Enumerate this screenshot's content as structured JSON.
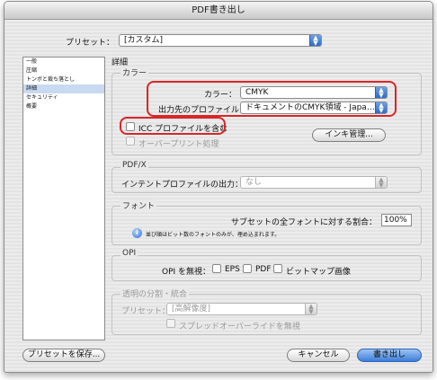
{
  "window": {
    "title": "PDF書き出し"
  },
  "preset": {
    "label": "プリセット：",
    "value": "[カスタム]"
  },
  "sidebar": {
    "items": [
      {
        "label": "一般"
      },
      {
        "label": "圧縮"
      },
      {
        "label": "トンボと裁ち落とし"
      },
      {
        "label": "詳細"
      },
      {
        "label": "セキュリティ"
      },
      {
        "label": "概要"
      }
    ]
  },
  "section_title": "詳細",
  "color": {
    "title": "カラー",
    "color_label": "カラー：",
    "color_value": "CMYK",
    "profile_label": "出力先のプロファイル：",
    "profile_value": "ドキュメントのCMYK領域 - Japa…",
    "icc_label": "ICC プロファイルを含む",
    "overprint_label": "オーバープリント処理",
    "ink_button": "インキ管理..."
  },
  "pdfx": {
    "title": "PDF/X",
    "intent_label": "インテントプロファイルの出力：",
    "intent_value": "なし"
  },
  "fonts": {
    "title": "フォント",
    "subset_label": "サブセットの全フォントに対する割合：",
    "subset_value": "100%",
    "note": "並び順はビット数のフォントのみが、埋め込まれます。"
  },
  "opi": {
    "title": "OPI",
    "omit_label": "OPI を無視：",
    "eps_label": "EPS",
    "pdf_label": "PDF",
    "bitmap_label": "ビットマップ画像"
  },
  "transparency": {
    "title": "透明の分割・統合",
    "preset_label": "プリセット：",
    "preset_value": "[高解像度]",
    "spread_label": "スプレッドオーバーライドを無視"
  },
  "buttons": {
    "save_preset": "プリセットを保存...",
    "cancel": "キャンセル",
    "export": "書き出し"
  },
  "colors": {
    "highlight_ring": "#d8262a",
    "popup_accent": "#2c6bcb",
    "selection": "#c8d9f2"
  }
}
